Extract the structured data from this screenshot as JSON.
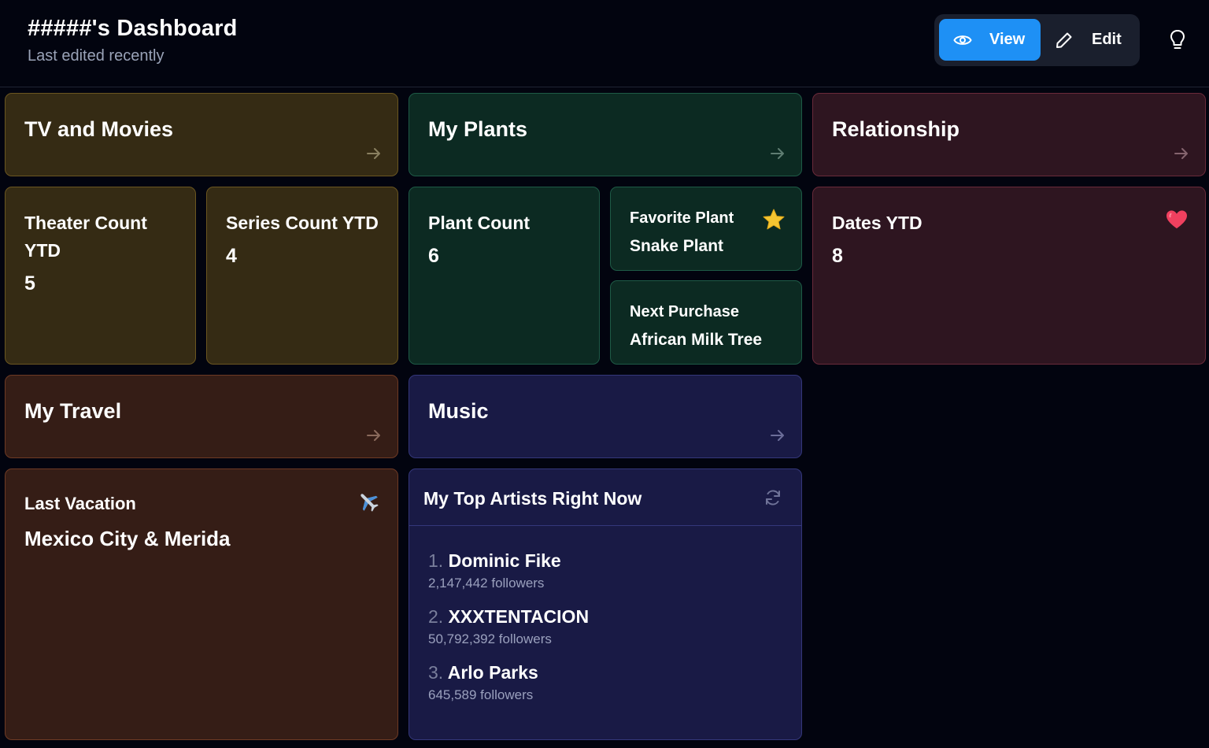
{
  "header": {
    "title": "#####'s Dashboard",
    "subtitle": "Last edited recently",
    "view_label": "View",
    "edit_label": "Edit"
  },
  "sections": {
    "tv": {
      "title": "TV and Movies"
    },
    "plants": {
      "title": "My Plants"
    },
    "relationship": {
      "title": "Relationship"
    },
    "travel": {
      "title": "My Travel"
    },
    "music": {
      "title": "Music"
    }
  },
  "stats": {
    "theater": {
      "label": "Theater Count YTD",
      "value": "5"
    },
    "series": {
      "label": "Series Count YTD",
      "value": "4"
    },
    "plant_count": {
      "label": "Plant Count",
      "value": "6"
    },
    "favorite_plant": {
      "label": "Favorite Plant",
      "value": "Snake Plant",
      "icon": "star-icon"
    },
    "next_purchase": {
      "label": "Next Purchase",
      "value": "African Milk Tree"
    },
    "dates": {
      "label": "Dates YTD",
      "value": "8",
      "icon": "heart-icon"
    },
    "vacation": {
      "label": "Last Vacation",
      "value": "Mexico City & Merida",
      "icon": "airplane-icon"
    }
  },
  "top_artists": {
    "title": "My Top Artists Right Now",
    "items": [
      {
        "rank": "1.",
        "name": "Dominic Fike",
        "followers": "2,147,442 followers"
      },
      {
        "rank": "2.",
        "name": "XXXTENTACION",
        "followers": "50,792,392 followers"
      },
      {
        "rank": "3.",
        "name": "Arlo Parks",
        "followers": "645,589 followers"
      }
    ]
  },
  "colors": {
    "background": "#02040f",
    "accent": "#1e90f5",
    "tv": "#352b14",
    "plants": "#0c2a22",
    "relationship": "#2e1520",
    "travel": "#351d16",
    "music": "#191a45"
  }
}
